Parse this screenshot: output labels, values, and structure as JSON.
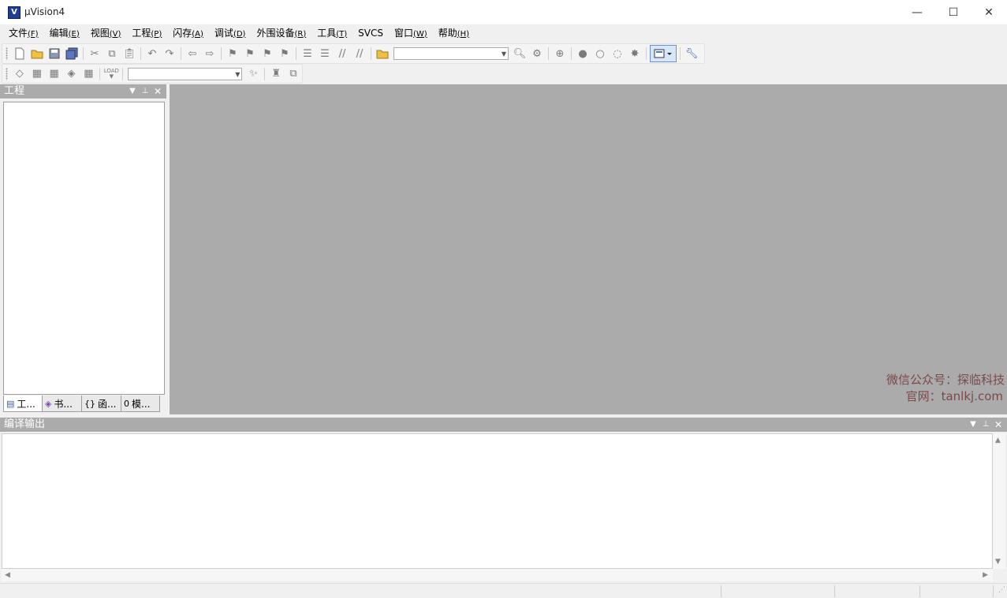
{
  "window": {
    "title": "µVision4",
    "app_icon": "V",
    "controls": {
      "minimize": "—",
      "maximize": "☐",
      "close": "✕"
    }
  },
  "menu": [
    {
      "label": "文件",
      "accel": "(F)"
    },
    {
      "label": "编辑",
      "accel": "(E)"
    },
    {
      "label": "视图",
      "accel": "(V)"
    },
    {
      "label": "工程",
      "accel": "(P)"
    },
    {
      "label": "闪存",
      "accel": "(A)"
    },
    {
      "label": "调试",
      "accel": "(D)"
    },
    {
      "label": "外围设备",
      "accel": "(R)"
    },
    {
      "label": "工具",
      "accel": "(T)"
    },
    {
      "label": "SVCS",
      "accel": ""
    },
    {
      "label": "窗口",
      "accel": "(W)"
    },
    {
      "label": "帮助",
      "accel": "(H)"
    }
  ],
  "toolbar1": {
    "combo_value": "",
    "icons": [
      "new-file-icon",
      "open-folder-icon",
      "save-icon",
      "save-all-icon",
      "cut-icon",
      "copy-icon",
      "paste-icon",
      "undo-icon",
      "redo-icon",
      "navigate-back-icon",
      "navigate-forward-icon",
      "bookmark-icon",
      "bookmark-prev-icon",
      "bookmark-next-icon",
      "bookmark-clear-icon",
      "indent-icon",
      "unindent-icon",
      "comment-icon",
      "uncomment-icon",
      "find-in-files-icon",
      "find-icon",
      "incremental-find-icon",
      "debug-session-icon",
      "breakpoint-icon",
      "breakpoint-disable-icon",
      "breakpoint-disable-all-icon",
      "breakpoint-kill-all-icon",
      "window-select-icon",
      "configure-icon"
    ]
  },
  "toolbar2": {
    "load_label": "LOAD",
    "combo_value": "",
    "icons": [
      "translate-icon",
      "build-icon",
      "rebuild-icon",
      "batch-build-icon",
      "stop-build-icon",
      "download-icon",
      "target-options-icon",
      "file-extensions-icon",
      "manage-components-icon"
    ]
  },
  "project_panel": {
    "title": "工程",
    "tabs": [
      {
        "icon": "project-tab-icon",
        "glyph": "▤",
        "label": "工..."
      },
      {
        "icon": "books-tab-icon",
        "glyph": "◈",
        "label": "书..."
      },
      {
        "icon": "functions-tab-icon",
        "glyph": "{}",
        "label": "函..."
      },
      {
        "icon": "templates-tab-icon",
        "glyph": "0",
        "label": "模..."
      }
    ]
  },
  "watermark": {
    "line1": "微信公众号：探临科技",
    "line2": "官网：tanlkj.com"
  },
  "output_panel": {
    "title": "编译输出",
    "content": ""
  },
  "colors": {
    "pane_header": "#ababab",
    "mdi_background": "#ababab",
    "accent": "#1f3f95"
  }
}
